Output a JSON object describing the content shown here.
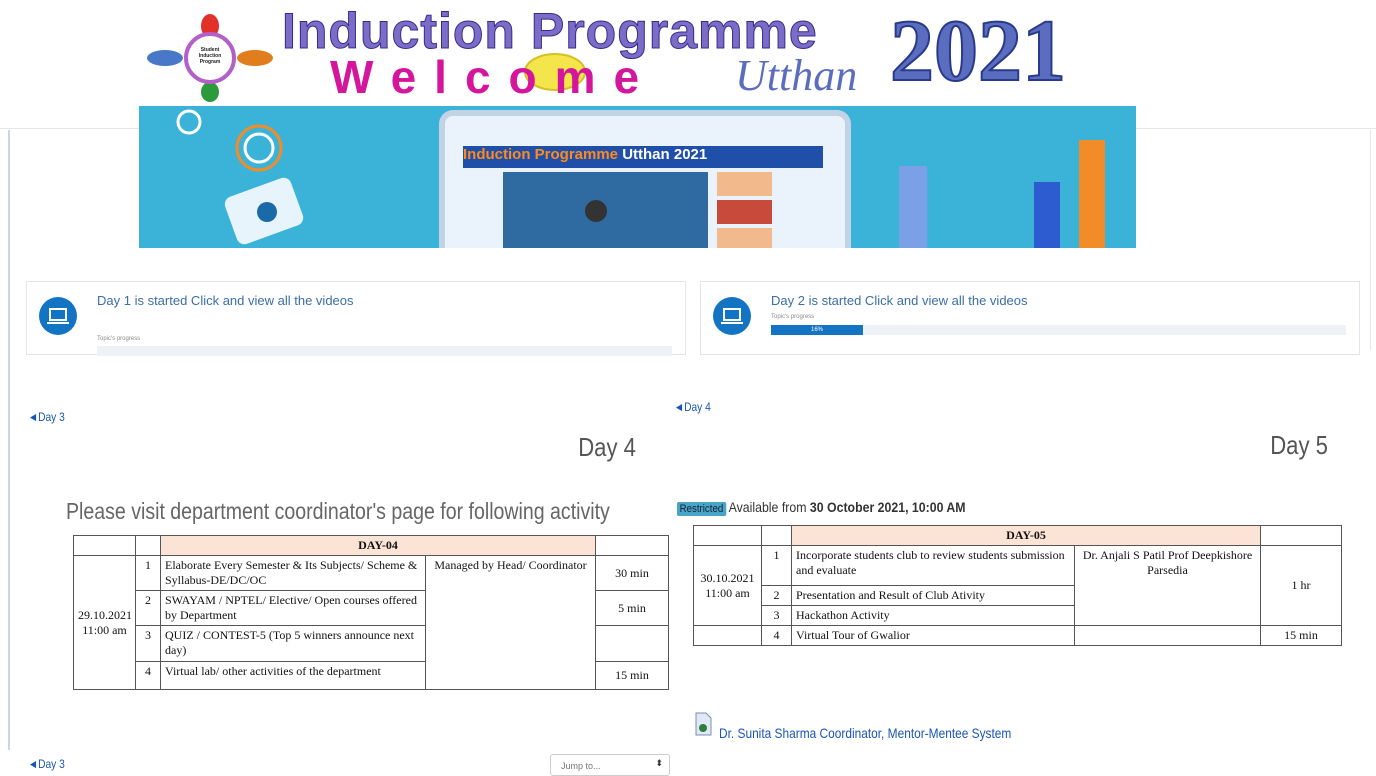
{
  "header": {
    "logo_text": "Student Induction Program",
    "title": "Induction Programme",
    "welcome": "Welcome",
    "utthan": "Utthan",
    "year": "2021"
  },
  "hero": {
    "tablet_title_a": "Induction Programme",
    "tablet_title_b": " Utthan 2021"
  },
  "cards": [
    {
      "title": "Day 1 is started Click and view all the videos",
      "progress_label": "Topic's progress",
      "progress_text": "",
      "progress": 0
    },
    {
      "title": "Day 2 is started Click and view all the videos",
      "progress_label": "Topic's progress",
      "progress_text": "16%",
      "progress": 16
    }
  ],
  "left": {
    "prev_link": "◄Day 3",
    "heading": "Day 4",
    "notice": "Please visit department coordinator's page for following activity",
    "table": {
      "title": "DAY-04",
      "date": "29.10.2021",
      "time": "11:00 am",
      "managed": "Managed by Head/ Coordinator",
      "rows": [
        {
          "no": "1",
          "activity": "Elaborate  Every Semester & Its Subjects/ Scheme & Syllabus-DE/DC/OC",
          "duration": "30 min"
        },
        {
          "no": "2",
          "activity": "SWAYAM / NPTEL/ Elective/ Open courses offered by Department",
          "duration": "5 min"
        },
        {
          "no": "3",
          "activity": "QUIZ / CONTEST-5 (Top 5 winners announce next day)",
          "duration": ""
        },
        {
          "no": "4",
          "activity": "Virtual lab/ other activities of the department",
          "duration": "15 min"
        }
      ]
    },
    "bottom_link": "◄Day 3",
    "jump_label": "Jump to..."
  },
  "right": {
    "prev_link": "◄Day 4",
    "heading": "Day 5",
    "restricted_badge": "Restricted",
    "available_prefix": "Available from ",
    "available_date": "30 October 2021, 10:00 AM",
    "table": {
      "title": "DAY-05",
      "date": "30.10.2021",
      "time": "11:00 am",
      "coordinator": "Dr. Anjali S Patil                Prof Deepkishore Parsedia",
      "rows": [
        {
          "no": "1",
          "activity": "Incorporate students club to review students submission and evaluate",
          "duration": "1 hr"
        },
        {
          "no": "2",
          "activity": "Presentation and Result of Club Ativity"
        },
        {
          "no": "3",
          "activity": "Hackathon Activity"
        },
        {
          "no": "4",
          "activity": "Virtual Tour of  Gwalior",
          "duration": "15 min"
        }
      ]
    },
    "file_link": "Dr. Sunita Sharma Coordinator, Mentor-Mentee System"
  },
  "colors": {
    "accent": "#1474c4",
    "link": "#1a55b5",
    "table_header": "#fbe4d5"
  }
}
